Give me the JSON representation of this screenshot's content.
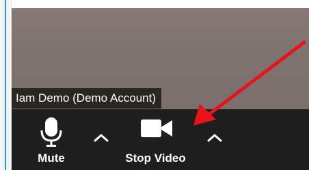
{
  "participant": {
    "name_label": "Iam Demo (Demo Account)"
  },
  "toolbar": {
    "mute_label": "Mute",
    "stop_video_label": "Stop Video"
  },
  "icons": {
    "mute": "microphone-icon",
    "audio_options": "chevron-up-icon",
    "video": "video-camera-icon",
    "video_options": "chevron-up-icon",
    "annotation": "red-arrow"
  },
  "colors": {
    "toolbar_bg": "#1f1f1f",
    "video_bg": "#807471",
    "label_text": "#ffffff",
    "annotation_arrow": "#e8141a",
    "accent_edge": "#2d8cff"
  }
}
